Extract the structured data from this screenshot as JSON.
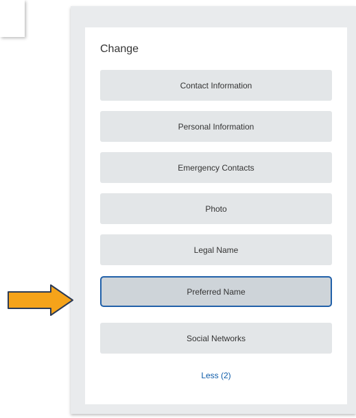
{
  "panel": {
    "title": "Change",
    "buttons": [
      {
        "label": "Contact Information"
      },
      {
        "label": "Personal Information"
      },
      {
        "label": "Emergency Contacts"
      },
      {
        "label": "Photo"
      },
      {
        "label": "Legal Name"
      },
      {
        "label": "Preferred Name",
        "highlighted": true
      },
      {
        "label": "Social Networks"
      }
    ],
    "less_link": "Less (2)"
  },
  "annotation": {
    "icon": "arrow-right-icon",
    "fill_color": "#f5a31a",
    "stroke_color": "#2b3a55"
  },
  "colors": {
    "accent_border": "#1f5fa8",
    "link": "#0b5aa8"
  }
}
